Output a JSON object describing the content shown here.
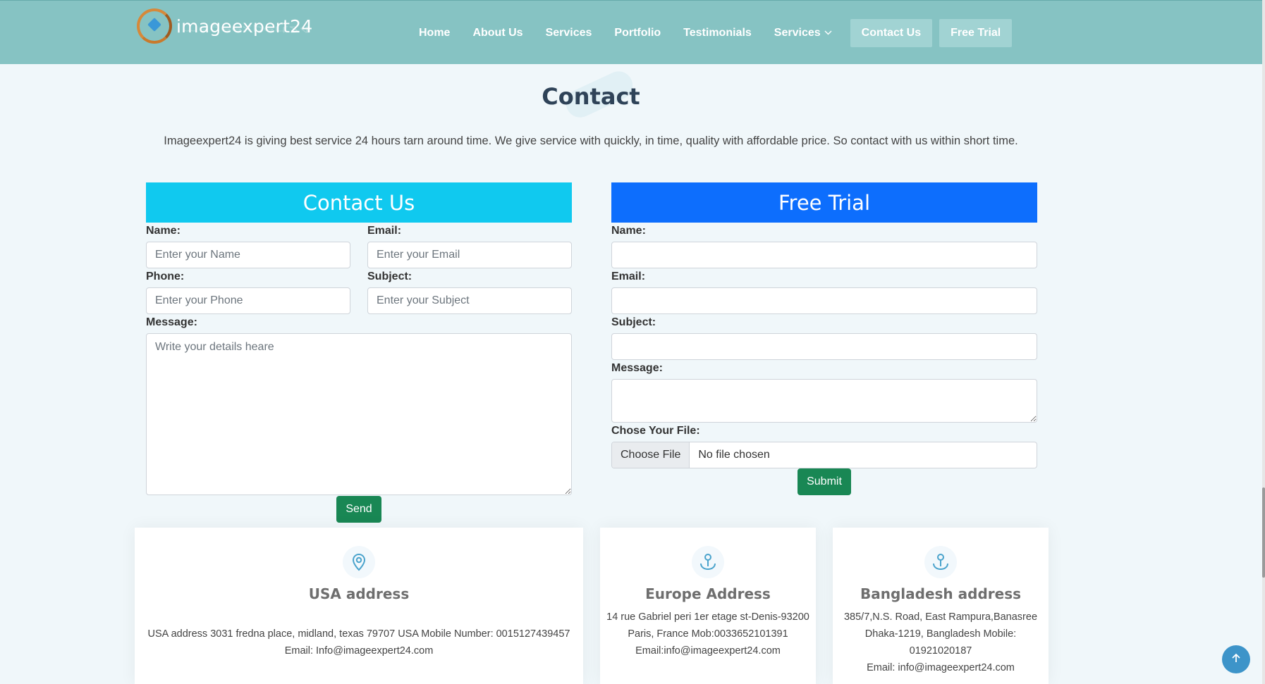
{
  "header": {
    "logo_text": "imageexpert24",
    "nav": [
      {
        "label": "Home"
      },
      {
        "label": "About Us"
      },
      {
        "label": "Services"
      },
      {
        "label": "Portfolio"
      },
      {
        "label": "Testimonials"
      },
      {
        "label": "Services",
        "has_dropdown": true
      },
      {
        "label": "Contact Us",
        "highlight": true
      },
      {
        "label": "Free Trial",
        "highlight": true
      }
    ]
  },
  "page": {
    "title": "Contact",
    "intro": "Imageexpert24 is giving best service 24 hours tarn around time. We give service with quickly, in time, quality with affordable price. So contact with us within short time."
  },
  "contact_form": {
    "heading": "Contact Us",
    "name_label": "Name:",
    "name_placeholder": "Enter your Name",
    "email_label": "Email:",
    "email_placeholder": "Enter your Email",
    "phone_label": "Phone:",
    "phone_placeholder": "Enter your Phone",
    "subject_label": "Subject:",
    "subject_placeholder": "Enter your Subject",
    "message_label": "Message:",
    "message_placeholder": "Write your details heare",
    "send_label": "Send"
  },
  "trial_form": {
    "heading": "Free Trial",
    "name_label": "Name:",
    "email_label": "Email:",
    "subject_label": "Subject:",
    "message_label": "Message:",
    "file_label": "Chose Your File:",
    "file_button": "Choose File",
    "file_status": "No file chosen",
    "submit_label": "Submit"
  },
  "addresses": [
    {
      "title": "USA address",
      "icon": "location-pin-icon",
      "lines": [
        "USA address 3031 fredna place, midland, texas 79707 USA Mobile Number: 0015127439457",
        "Email: Info@imageexpert24.com"
      ]
    },
    {
      "title": "Europe Address",
      "icon": "map-pin-anchor-icon",
      "lines": [
        "14 rue Gabriel peri 1er etage st-Denis-93200",
        "Paris, France Mob:0033652101391",
        "Email:info@imageexpert24.com"
      ]
    },
    {
      "title": "Bangladesh address",
      "icon": "map-pin-anchor-icon",
      "lines": [
        "385/7,N.S. Road, East Rampura,Banasree",
        "Dhaka-1219, Bangladesh Mobile: 01921020187",
        "Email: info@imageexpert24.com"
      ]
    }
  ],
  "colors": {
    "header_bg": "#86c3c3",
    "contact_head": "#10c9ef",
    "trial_head": "#0d6efd",
    "button_green": "#198754",
    "scroll_top": "#3d94c9"
  },
  "scroll_top_icon": "arrow-up-icon"
}
